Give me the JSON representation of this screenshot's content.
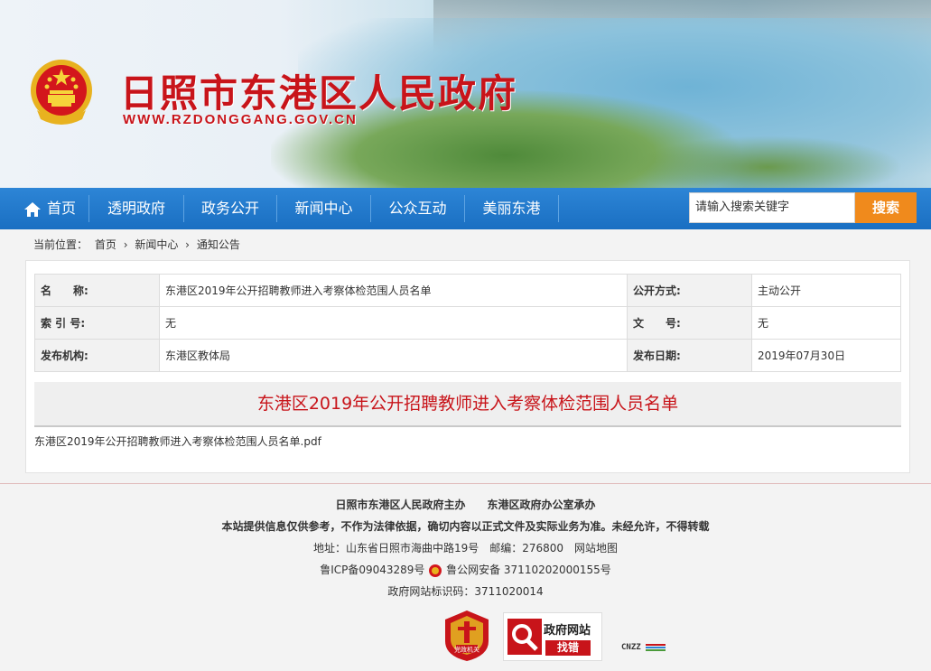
{
  "header": {
    "title": "日照市东港区人民政府",
    "url": "WWW.RZDONGGANG.GOV.CN"
  },
  "nav": {
    "items": [
      "首页",
      "透明政府",
      "政务公开",
      "新闻中心",
      "公众互动",
      "美丽东港"
    ],
    "search_placeholder": "请输入搜索关键字",
    "search_label": "搜索"
  },
  "breadcrumb": {
    "prefix": "当前位置：",
    "items": [
      "首页",
      "新闻中心",
      "通知公告"
    ],
    "separator": "›"
  },
  "meta": {
    "name_label": "名　　称:",
    "name_value": "东港区2019年公开招聘教师进入考察体检范围人员名单",
    "disclosure_label": "公开方式:",
    "disclosure_value": "主动公开",
    "index_label": "索 引 号:",
    "index_value": "无",
    "docno_label": "文　　号:",
    "docno_value": "无",
    "org_label": "发布机构:",
    "org_value": "东港区教体局",
    "date_label": "发布日期:",
    "date_value": "2019年07月30日"
  },
  "article": {
    "title": "东港区2019年公开招聘教师进入考察体检范围人员名单",
    "attachment": "东港区2019年公开招聘教师进入考察体检范围人员名单.pdf"
  },
  "footer": {
    "line1a": "日照市东港区人民政府主办",
    "line1b": "东港区政府办公室承办",
    "line2": "本站提供信息仅供参考，不作为法律依据，确切内容以正式文件及实际业务为准。未经允许，不得转载",
    "address": "地址：山东省日照市海曲中路19号　邮编：276800　网站地图",
    "icp": "鲁ICP备09043289号",
    "police": "鲁公网安备 37110202000155号",
    "site_id": "政府网站标识码：3711020014",
    "badge1_text": "党政机关",
    "badge2_title": "政府网站",
    "badge2_sub": "找错",
    "badge3_text": "CNZZ"
  },
  "colors": {
    "brand_red": "#c8141a",
    "nav_blue": "#1a6fc2",
    "search_orange": "#f08a1c"
  },
  "icons": {
    "emblem": "national-emblem-icon",
    "home": "home-icon",
    "police": "police-badge-icon"
  }
}
